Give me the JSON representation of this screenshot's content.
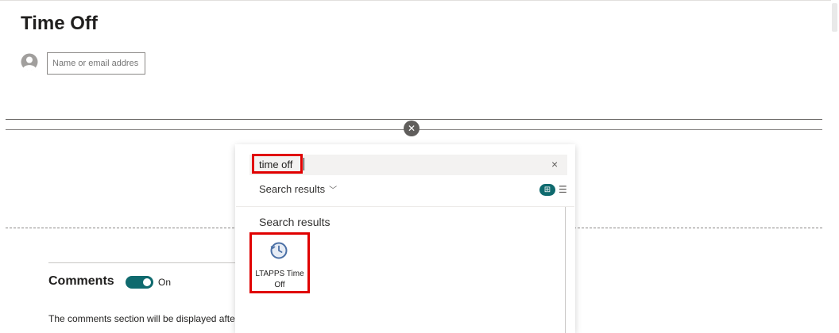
{
  "page": {
    "title": "Time Off",
    "people_picker_placeholder": "Name or email addres"
  },
  "comments": {
    "title": "Comments",
    "toggle_state": "On",
    "note": "The comments section will be displayed after t"
  },
  "picker": {
    "search_value": "time off",
    "filter_label": "Search results",
    "results_heading": "Search results",
    "results": [
      {
        "label": "LTAPPS Time Off",
        "icon": "clock-refresh-icon"
      }
    ]
  },
  "icons": {
    "close": "close-icon",
    "clear": "clear-search-icon",
    "chevron": "chevron-down-icon",
    "grid_view": "grid-view-icon",
    "list_view": "list-view-icon",
    "avatar": "person-icon"
  },
  "colors": {
    "accent": "#0f6a6e",
    "highlight": "#e00000"
  }
}
